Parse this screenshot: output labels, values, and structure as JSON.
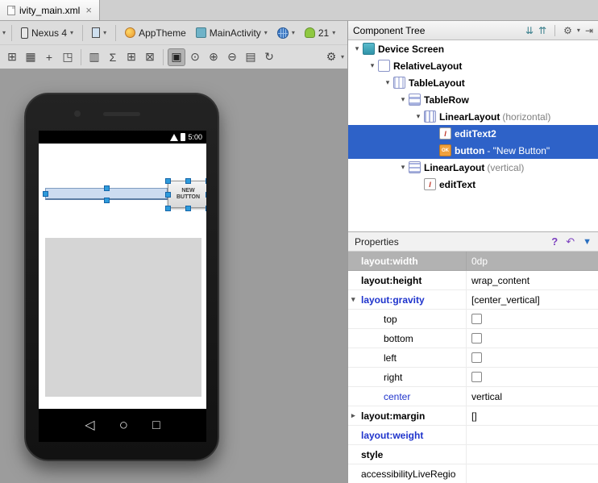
{
  "icons": {
    "dropdown": "▾",
    "close": "×",
    "gear": "⚙",
    "grid": "⊞",
    "grid_options": "▦",
    "snap": "+",
    "expand_selection": "◳",
    "col_struct": "▥",
    "sigma": "Σ",
    "table_cols": "⊞",
    "table_border": "⊠",
    "pan": "▣",
    "zoom_fit": "⊙",
    "zoom_in": "⊕",
    "zoom_out": "⊖",
    "doc": "▤",
    "refresh": "↻",
    "expand_all": "⇊",
    "collapse_all": "⇈",
    "pin_right": "⇥",
    "help": "?",
    "undo": "↶",
    "filter": "▼",
    "arrow_expanded": "▾",
    "arrow_collapsed": "▸",
    "button_glyph": "OK",
    "edittext_glyph": "I",
    "nav_back": "◁",
    "nav_home": "○",
    "nav_recents": "□"
  },
  "tab": {
    "title": "ivity_main.xml"
  },
  "toolbar": {
    "device": "Nexus 4",
    "theme": "AppTheme",
    "activity": "MainActivity",
    "api_level": "21"
  },
  "component_tree": {
    "title": "Component Tree",
    "nodes": [
      {
        "label": "Device Screen",
        "icon": "device",
        "indent": 0,
        "expanded": true,
        "selected": false
      },
      {
        "label": "RelativeLayout",
        "icon": "relativelayout",
        "indent": 1,
        "expanded": true,
        "selected": false
      },
      {
        "label": "TableLayout",
        "icon": "tablelayout",
        "indent": 2,
        "expanded": true,
        "selected": false
      },
      {
        "label": "TableRow",
        "icon": "tablerow",
        "indent": 3,
        "expanded": true,
        "selected": false
      },
      {
        "label": "LinearLayout",
        "suffix": " (horizontal)",
        "icon": "linearlayout-h",
        "indent": 4,
        "expanded": true,
        "selected": false
      },
      {
        "label": "editText2",
        "icon": "edittext",
        "indent": 5,
        "selected": true
      },
      {
        "label": "button",
        "suffix": " - \"New Button\"",
        "icon": "button",
        "indent": 5,
        "selected": true
      },
      {
        "label": "LinearLayout",
        "suffix": " (vertical)",
        "icon": "linearlayout-v",
        "indent": 3,
        "expanded": true,
        "selected": false
      },
      {
        "label": "editText",
        "icon": "edittext",
        "indent": 4,
        "selected": false
      }
    ]
  },
  "properties": {
    "title": "Properties",
    "rows": [
      {
        "name": "layout:width",
        "value": "0dp",
        "bold": true,
        "selected": true
      },
      {
        "name": "layout:height",
        "value": "wrap_content",
        "bold": true
      },
      {
        "name": "layout:gravity",
        "value": "[center_vertical]",
        "bold": true,
        "blue": true,
        "arrow": "down"
      },
      {
        "name": "top",
        "checkbox": true,
        "indent": true
      },
      {
        "name": "bottom",
        "checkbox": true,
        "indent": true
      },
      {
        "name": "left",
        "checkbox": true,
        "indent": true
      },
      {
        "name": "right",
        "checkbox": true,
        "indent": true
      },
      {
        "name": "center",
        "value": "vertical",
        "blue": true,
        "indent": true
      },
      {
        "name": "layout:margin",
        "value": "[]",
        "bold": true,
        "arrow": "right"
      },
      {
        "name": "layout:weight",
        "value": "",
        "bold": true,
        "blue": true
      },
      {
        "name": "style",
        "value": "",
        "bold": true
      },
      {
        "name": "accessibilityLiveRegio",
        "value": ""
      }
    ]
  },
  "phone": {
    "status_time": "5:00",
    "button_label": "NEW BUTTON"
  }
}
